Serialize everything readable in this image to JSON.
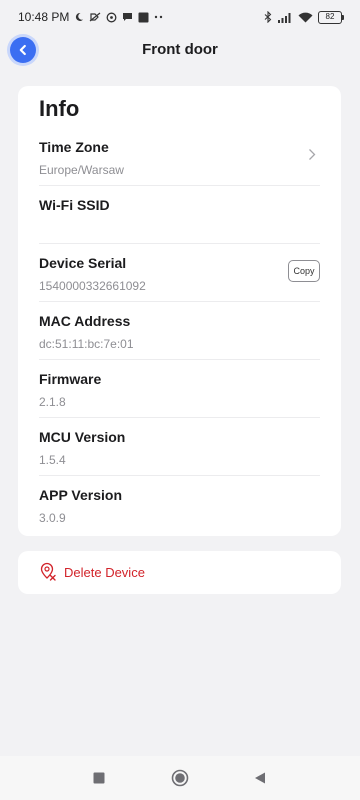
{
  "status_bar": {
    "time": "10:48 PM",
    "battery": "82",
    "left_icons": [
      "moon-icon",
      "mute-icon",
      "whatsapp-icon",
      "chat-icon",
      "app-icon",
      "more-dots-icon"
    ],
    "right_icons": [
      "bluetooth-icon",
      "signal-icon",
      "wifi-icon",
      "battery-icon"
    ]
  },
  "header": {
    "title": "Front door",
    "back_icon": "chevron-left-icon",
    "accent_color": "#3b6ef2"
  },
  "info": {
    "title": "Info",
    "rows": [
      {
        "label": "Time Zone",
        "value": "Europe/Warsaw",
        "action": "chevron-right-icon"
      },
      {
        "label": "Wi-Fi SSID",
        "value": ""
      },
      {
        "label": "Device Serial",
        "value": "1540000332661092",
        "action_label": "Copy"
      },
      {
        "label": "MAC Address",
        "value": "dc:51:11:bc:7e:01"
      },
      {
        "label": "Firmware",
        "value": "2.1.8"
      },
      {
        "label": "MCU Version",
        "value": "1.5.4"
      },
      {
        "label": "APP Version",
        "value": "3.0.9"
      }
    ]
  },
  "delete": {
    "label": "Delete Device",
    "icon": "delete-device-icon",
    "color": "#d2232a"
  },
  "nav": {
    "icons": [
      "recents-square-icon",
      "home-circle-icon",
      "back-triangle-icon"
    ]
  }
}
